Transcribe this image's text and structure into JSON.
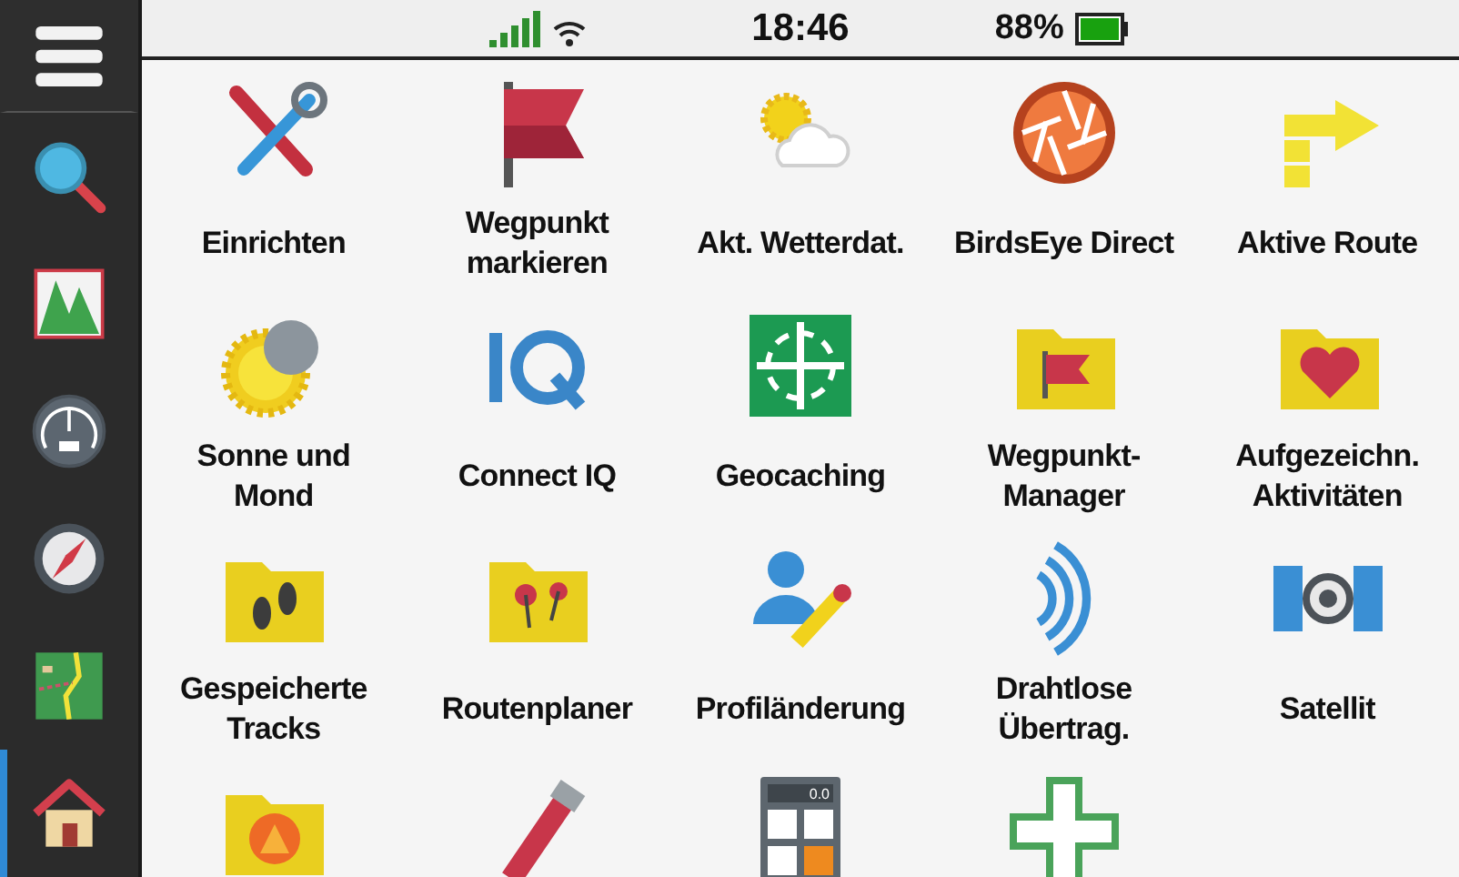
{
  "sidebar": {
    "items": [
      {
        "kind": "menu",
        "selected": false
      },
      {
        "kind": "search",
        "selected": false
      },
      {
        "kind": "chart",
        "selected": false
      },
      {
        "kind": "gauge",
        "selected": false
      },
      {
        "kind": "compass",
        "selected": false
      },
      {
        "kind": "map",
        "selected": false
      },
      {
        "kind": "home",
        "selected": true
      }
    ]
  },
  "status_bar": {
    "time": "18:46",
    "battery": "88%"
  },
  "apps": [
    {
      "kind": "tools",
      "label": "Einrichten"
    },
    {
      "kind": "flag",
      "label": "Wegpunkt\nmarkieren"
    },
    {
      "kind": "weather",
      "label": "Akt. Wetterdat."
    },
    {
      "kind": "birdseye",
      "label": "BirdsEye Direct"
    },
    {
      "kind": "route",
      "label": "Aktive Route"
    },
    {
      "kind": "sunmoon",
      "label": "Sonne und\nMond"
    },
    {
      "kind": "iq",
      "label": "Connect IQ"
    },
    {
      "kind": "geocache",
      "label": "Geocaching"
    },
    {
      "kind": "folder-flag",
      "label": "Wegpunkt-\nManager"
    },
    {
      "kind": "folder-heart",
      "label": "Aufgezeichn.\nAktivitäten"
    },
    {
      "kind": "folder-steps",
      "label": "Gespeicherte\nTracks"
    },
    {
      "kind": "folder-pins",
      "label": "Routenplaner"
    },
    {
      "kind": "profile",
      "label": "Profiländerung"
    },
    {
      "kind": "wireless",
      "label": "Drahtlose\nÜbertrag."
    },
    {
      "kind": "satellite",
      "label": "Satellit"
    },
    {
      "kind": "folder-flame"
    },
    {
      "kind": "flashlight"
    },
    {
      "kind": "calculator",
      "display": "0.0"
    },
    {
      "kind": "plus"
    }
  ]
}
